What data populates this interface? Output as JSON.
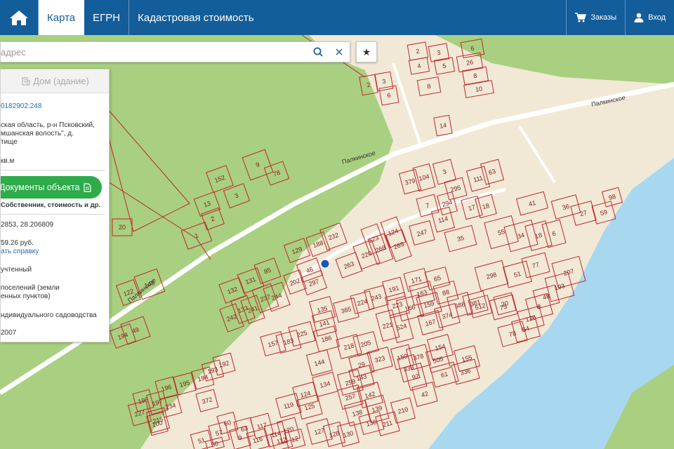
{
  "topbar": {
    "tabs": [
      "Карта",
      "ЕГРН",
      "Кадастровая стоимость"
    ],
    "orders_label": "Заказы",
    "login_label": "Вход"
  },
  "search": {
    "placeholder": "адрес"
  },
  "panel": {
    "tab_house": "Дом (здание)",
    "cadastral_number": "0182902:248",
    "address_line1": "ская область, р-н Псковский,",
    "address_line2": "мшанская волость\", д.",
    "address_line3": "тище",
    "area_unit": "кв.м",
    "documents_button": "Документы объекта",
    "documents_sub": "Собственник, стоимость и др.",
    "coords": "2853, 28.206809",
    "cost": "59.26 руб.",
    "cert_link": "ать справку",
    "status": "учтенный",
    "category_line1": "поселений (земли",
    "category_line2": "енных пунктов)",
    "usage": "ндивидуального садоводства",
    "year": "2007"
  },
  "map": {
    "road_labels": [
      "Палкинское",
      "Палкинское",
      "Палкинское"
    ],
    "plots": [
      "2",
      "3",
      "4",
      "5",
      "6",
      "26",
      "8",
      "10",
      "8",
      "2",
      "3",
      "6",
      "14",
      "104",
      "379",
      "3",
      "295",
      "111",
      "63",
      "17",
      "18",
      "7",
      "294",
      "114",
      "41",
      "36",
      "27",
      "59",
      "98",
      "152",
      "9",
      "78",
      "13",
      "2",
      "3",
      "1",
      "20",
      "247",
      "55",
      "34",
      "18",
      "6",
      "35",
      "232",
      "188",
      "129",
      "123",
      "124",
      "268",
      "269",
      "263",
      "220",
      "46",
      "297",
      "202",
      "298",
      "51",
      "77",
      "207",
      "193",
      "122",
      "145",
      "85",
      "131",
      "132",
      "133",
      "241",
      "242",
      "237",
      "244",
      "243",
      "191",
      "171",
      "65",
      "163",
      "88",
      "48",
      "8",
      "126",
      "73",
      "54",
      "78",
      "49",
      "194",
      "135",
      "141",
      "365",
      "224",
      "223",
      "221",
      "524",
      "166",
      "159",
      "388",
      "381",
      "512",
      "167",
      "374",
      "186",
      "225",
      "183",
      "157",
      "155",
      "154",
      "505",
      "378",
      "218",
      "205",
      "144",
      "29",
      "323",
      "150",
      "339",
      "92",
      "336",
      "61",
      "42",
      "119",
      "124",
      "125",
      "134",
      "259",
      "257",
      "143",
      "142",
      "138",
      "136",
      "139",
      "211",
      "210",
      "198",
      "196",
      "195",
      "194",
      "193",
      "197",
      "192",
      "234",
      "227",
      "215",
      "372",
      "127",
      "128",
      "130",
      "120",
      "117",
      "114",
      "116",
      "112",
      "12",
      "9",
      "63",
      "60",
      "57",
      "51",
      "50",
      "20",
      "100",
      "11",
      "515"
    ]
  },
  "colors": {
    "brand_blue": "#135d9a",
    "green_button": "#2eab4a",
    "plot_red": "#c0262d",
    "forest_green": "#a8d080",
    "water_blue": "#a7d8f0",
    "settlement_beige": "#f1e9d6",
    "selected_dot": "#1a56b5"
  },
  "icons": {
    "home": "home-icon",
    "cart": "cart-icon",
    "user": "user-icon",
    "search": "search-icon",
    "clear": "close-icon",
    "star": "star-icon",
    "building": "building-icon",
    "document": "document-icon"
  }
}
